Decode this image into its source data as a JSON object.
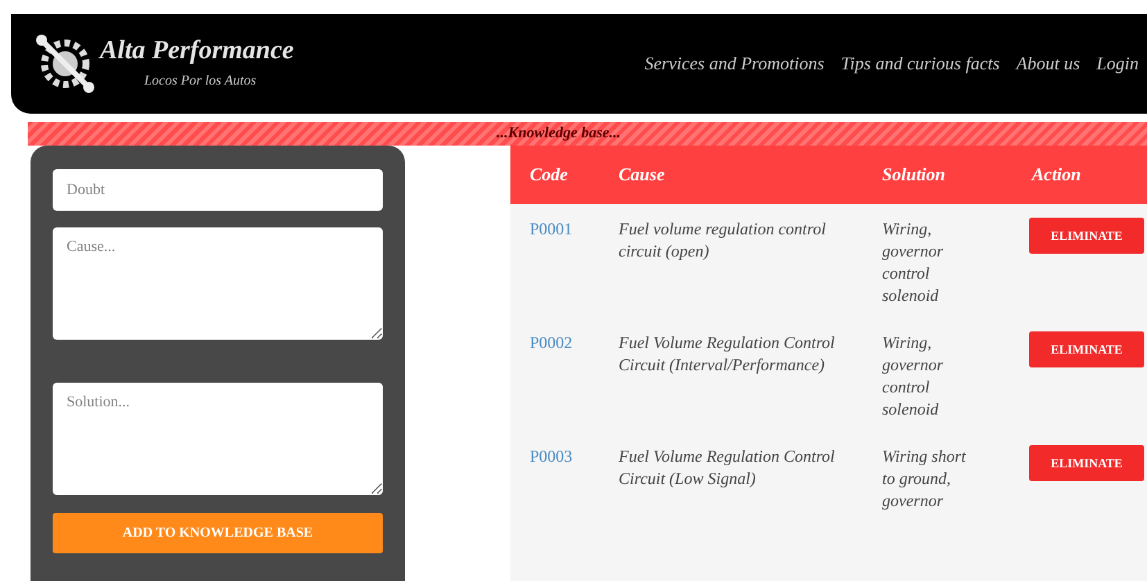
{
  "brand": {
    "title": "Alta Performance",
    "tagline": "Locos Por los Autos"
  },
  "nav": [
    "Services and Promotions",
    "Tips and curious facts",
    "About us",
    "Login"
  ],
  "section_title": "...Knowledge base...",
  "form": {
    "fields": [
      {
        "kind": "input",
        "placeholder": "Doubt"
      },
      {
        "kind": "textarea",
        "placeholder": "Cause..."
      },
      {
        "kind": "textarea",
        "placeholder": "Solution..."
      }
    ],
    "submit": "ADD TO KNOWLEDGE BASE"
  },
  "table": {
    "columns": [
      "Code",
      "Cause",
      "Solution",
      "Action"
    ],
    "rows": [
      {
        "code": "P0001",
        "cause": "Fuel volume regulation control circuit (open)",
        "solution": "Wiring, governor control solenoid",
        "action": "ELIMINATE"
      },
      {
        "code": "P0002",
        "cause": "Fuel Volume Regulation Control Circuit (Interval/Performance)",
        "solution": "Wiring, governor control solenoid",
        "action": "ELIMINATE"
      },
      {
        "code": "P0003",
        "cause": "Fuel Volume Regulation Control Circuit (Low Signal)",
        "solution": "Wiring short to ground, governor",
        "action": "ELIMINATE"
      }
    ]
  }
}
